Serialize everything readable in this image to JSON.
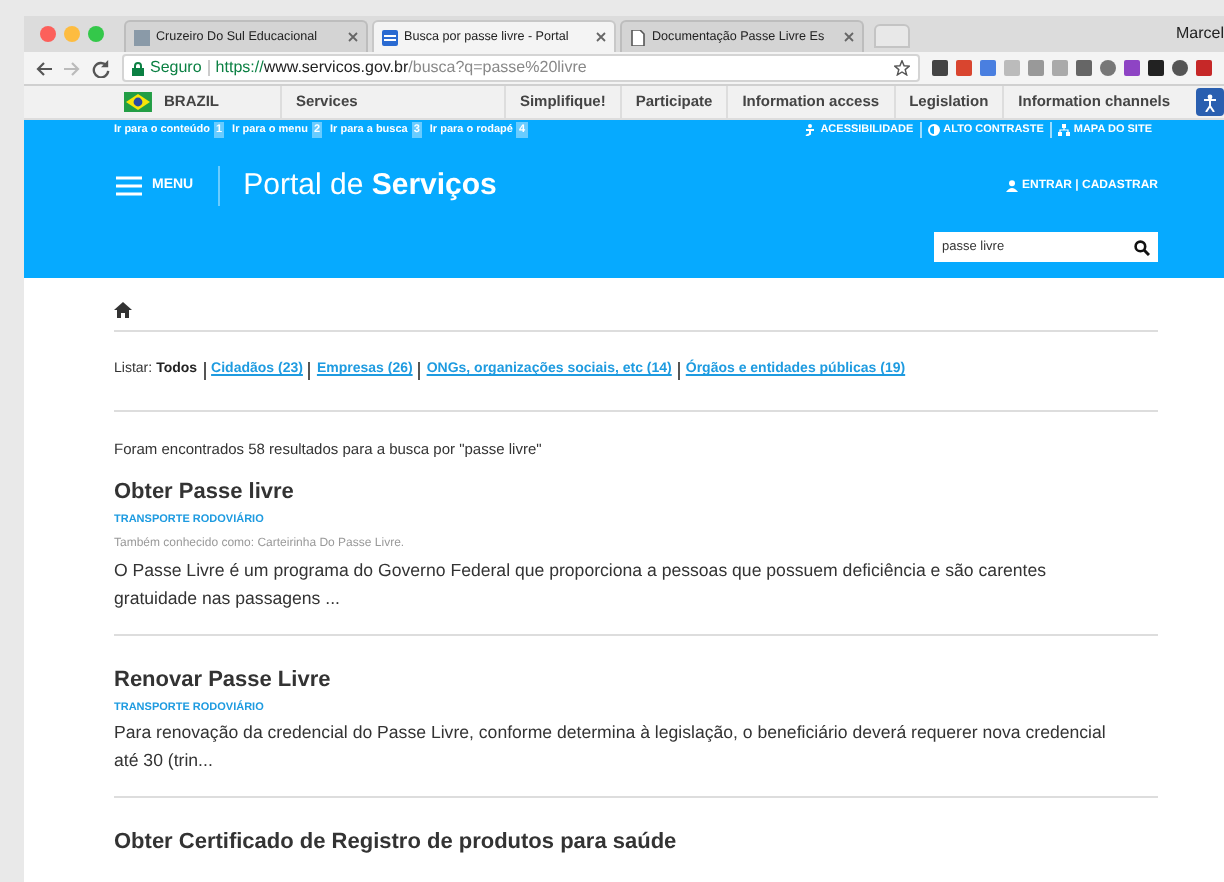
{
  "browser": {
    "tabs": [
      {
        "title": "Cruzeiro Do Sul Educacional",
        "selected": false
      },
      {
        "title": "Busca por passe livre - Portal",
        "selected": true
      },
      {
        "title": "Documentação Passe Livre Es",
        "selected": false
      }
    ],
    "profile": "Marcel",
    "address": {
      "secure_label": "Seguro",
      "scheme": "https://",
      "host": "www.servicos.gov.br",
      "path": "/busca?q=passe%20livre"
    }
  },
  "gov_bar": {
    "country": "BRAZIL",
    "links": [
      "Services",
      "Simplifique!",
      "Participate",
      "Information access",
      "Legislation",
      "Information channels"
    ]
  },
  "skip_links": [
    {
      "label": "Ir para o conteúdo",
      "key": "1"
    },
    {
      "label": "Ir para o menu",
      "key": "2"
    },
    {
      "label": "Ir para a busca",
      "key": "3"
    },
    {
      "label": "Ir para o rodapé",
      "key": "4"
    }
  ],
  "accessibility_links": [
    {
      "label": "ACESSIBILIDADE"
    },
    {
      "label": "ALTO CONTRASTE"
    },
    {
      "label": "MAPA DO SITE"
    }
  ],
  "header": {
    "menu_label": "MENU",
    "title": "Portal de **Serviços**",
    "login": "ENTRAR | CADASTRAR",
    "search_value": "passe livre"
  },
  "filters": {
    "label": "Listar:",
    "items": [
      {
        "label": "Todos",
        "selected": true
      },
      {
        "label": "Cidadãos (23)",
        "selected": false
      },
      {
        "label": "Empresas (26)",
        "selected": false
      },
      {
        "label": "ONGs, organizações sociais, etc (14)",
        "selected": false
      },
      {
        "label": "Órgãos e entidades públicas (19)",
        "selected": false
      }
    ]
  },
  "results_summary": "Foram encontrados 58 resultados para a busca por \"passe livre\"",
  "results": [
    {
      "title": "Obter Passe livre",
      "category": "TRANSPORTE RODOVIÁRIO",
      "aka": "Também conhecido como: Carteirinha Do Passe Livre.",
      "description": "O Passe Livre é um programa do Governo Federal que proporciona a pessoas que possuem deficiência e são carentes gratuidade nas passagens ..."
    },
    {
      "title": "Renovar Passe Livre",
      "category": "TRANSPORTE RODOVIÁRIO",
      "description": "Para renovação da credencial do Passe Livre, conforme determina à legislação, o beneficiário deverá requerer nova credencial até 30 (trin..."
    },
    {
      "title": "Obter Certificado de Registro de produtos para saúde"
    }
  ]
}
